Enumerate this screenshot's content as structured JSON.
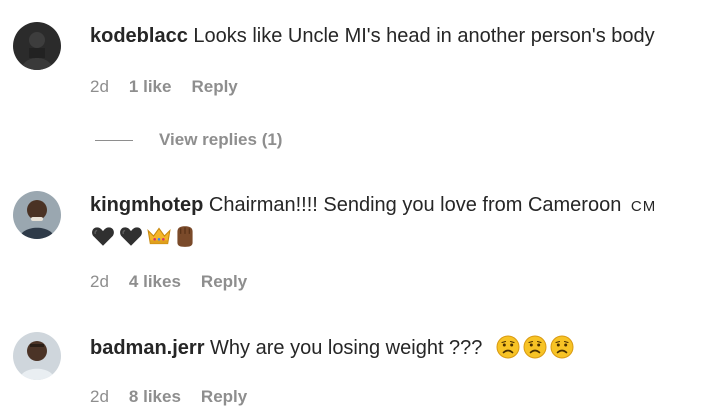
{
  "comments": [
    {
      "username": "kodeblacc",
      "text": "Looks like Uncle MI's head in another person's body",
      "time": "2d",
      "likes": "1 like",
      "reply_label": "Reply",
      "view_replies": "View replies (1)",
      "avatar_icon": "avatar-photo-icon"
    },
    {
      "username": "kingmhotep",
      "text": "Chairman!!!! Sending you love from Cameroon",
      "flag_text": "CM",
      "emojis": [
        "black-heart-emoji",
        "black-heart-emoji",
        "crown-emoji",
        "raised-fist-emoji"
      ],
      "time": "2d",
      "likes": "4 likes",
      "reply_label": "Reply",
      "avatar_icon": "avatar-photo-icon"
    },
    {
      "username": "badman.jerr",
      "text": "Why are you losing weight ???",
      "emojis": [
        "sad-face-emoji",
        "sad-face-emoji",
        "sad-face-emoji"
      ],
      "time": "2d",
      "likes": "8 likes",
      "reply_label": "Reply",
      "avatar_icon": "avatar-photo-icon"
    }
  ],
  "colors": {
    "text": "#262626",
    "meta": "#8e8e8e"
  }
}
